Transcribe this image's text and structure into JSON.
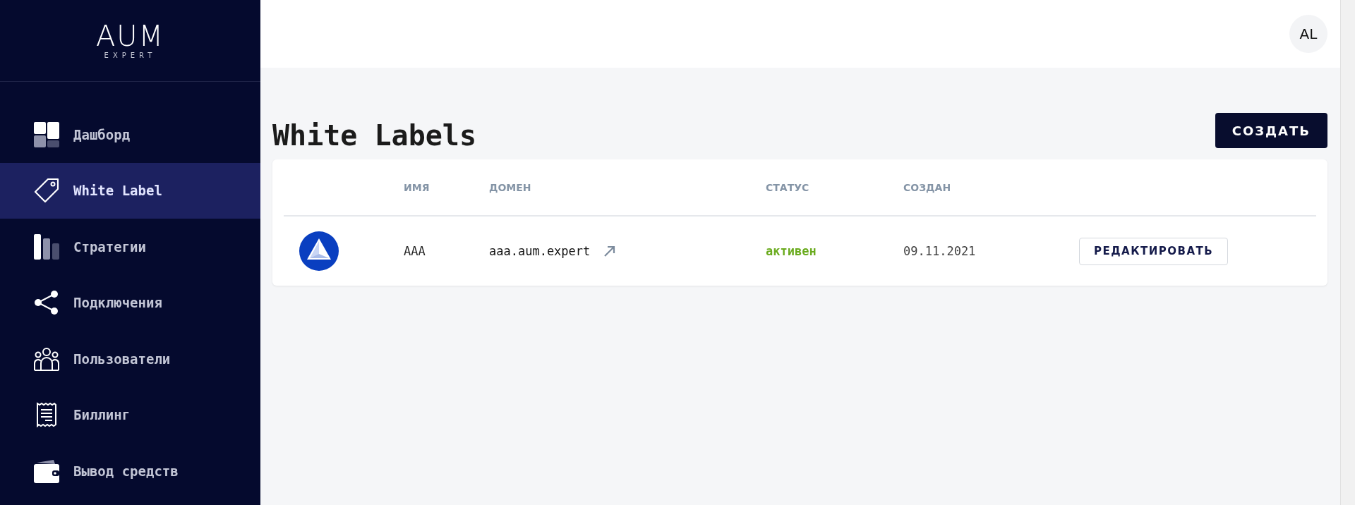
{
  "logo": {
    "name": "AUM",
    "subtitle": "EXPERT"
  },
  "sidebar": {
    "items": [
      {
        "label": "Дашборд",
        "selected": false
      },
      {
        "label": "White Label",
        "selected": true
      },
      {
        "label": "Стратегии",
        "selected": false
      },
      {
        "label": "Подключения",
        "selected": false
      },
      {
        "label": "Пользователи",
        "selected": false
      },
      {
        "label": "Биллинг",
        "selected": false
      },
      {
        "label": "Вывод средств",
        "selected": false
      }
    ]
  },
  "header": {
    "avatar": "AL"
  },
  "page": {
    "title": "White Labels",
    "create_button": "СОЗДАТЬ"
  },
  "table": {
    "columns": [
      "ИМЯ",
      "ДОМЕН",
      "СТАТУС",
      "СОЗДАН"
    ],
    "rows": [
      {
        "name": "AAA",
        "domain": "aaa.aum.expert",
        "status": "активен",
        "active": true,
        "created": "09.11.2021",
        "action": "РЕДАКТИРОВАТЬ"
      }
    ]
  }
}
